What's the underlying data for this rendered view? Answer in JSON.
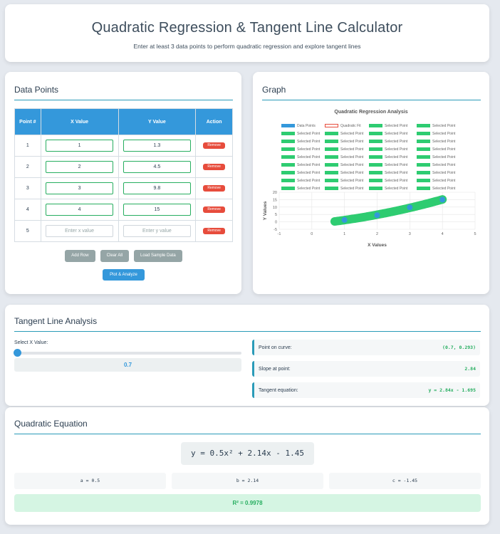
{
  "header": {
    "title": "Quadratic Regression & Tangent Line Calculator",
    "subtitle": "Enter at least 3 data points to perform quadratic regression and explore tangent lines"
  },
  "data_points": {
    "title": "Data Points",
    "columns": [
      "Point #",
      "X Value",
      "Y Value",
      "Action"
    ],
    "rows": [
      {
        "n": "1",
        "x": "1",
        "y": "1.3"
      },
      {
        "n": "2",
        "x": "2",
        "y": "4.5"
      },
      {
        "n": "3",
        "x": "3",
        "y": "9.8"
      },
      {
        "n": "4",
        "x": "4",
        "y": "15"
      },
      {
        "n": "5",
        "x": "",
        "y": ""
      }
    ],
    "x_placeholder": "Enter x value",
    "y_placeholder": "Enter y value",
    "remove_label": "Remove",
    "add_row_label": "Add Row",
    "clear_all_label": "Clear All",
    "load_sample_label": "Load Sample Data",
    "plot_label": "Plot & Analyze"
  },
  "graph": {
    "title": "Graph",
    "legend_first_row": [
      "Data Points",
      "Quadratic Fit",
      "Selected Point",
      "Selected Point"
    ],
    "legend_repeat_label": "Selected Point",
    "colors": {
      "data": "#3498db",
      "fit": "#e74c3c",
      "selected": "#2ecc71"
    }
  },
  "chart_data": {
    "type": "scatter",
    "title": "Quadratic Regression Analysis",
    "xlabel": "X Values",
    "ylabel": "Y Values",
    "xlim": [
      -1,
      5
    ],
    "ylim": [
      -5,
      20
    ],
    "xticks": [
      "-1",
      "0",
      "1",
      "2",
      "3",
      "4",
      "5"
    ],
    "yticks": [
      "20",
      "15",
      "10",
      "5",
      "0",
      "-5"
    ],
    "series": [
      {
        "name": "Data Points",
        "x": [
          1,
          2,
          3,
          4
        ],
        "y": [
          1.3,
          4.5,
          9.8,
          15
        ]
      }
    ],
    "selected_points": {
      "x_start": 0.7,
      "x_end": 4.0
    },
    "fit": {
      "a": 0.5,
      "b": 2.14,
      "c": -1.45
    }
  },
  "tangent": {
    "title": "Tangent Line Analysis",
    "slider_label": "Select X Value:",
    "slider_value": "0.7",
    "slider_fraction": 0.0,
    "point_label": "Point on curve:",
    "point_value": "(0.7, 0.293)",
    "slope_label": "Slope at point:",
    "slope_value": "2.84",
    "equation_label": "Tangent equation:",
    "equation_value": "y = 2.84x - 1.695"
  },
  "quadratic": {
    "title": "Quadratic Equation",
    "equation": "y = 0.5x² + 2.14x - 1.45",
    "a": "a = 0.5",
    "b": "b = 2.14",
    "c": "c = -1.45",
    "r2": "R² = 0.9978"
  }
}
